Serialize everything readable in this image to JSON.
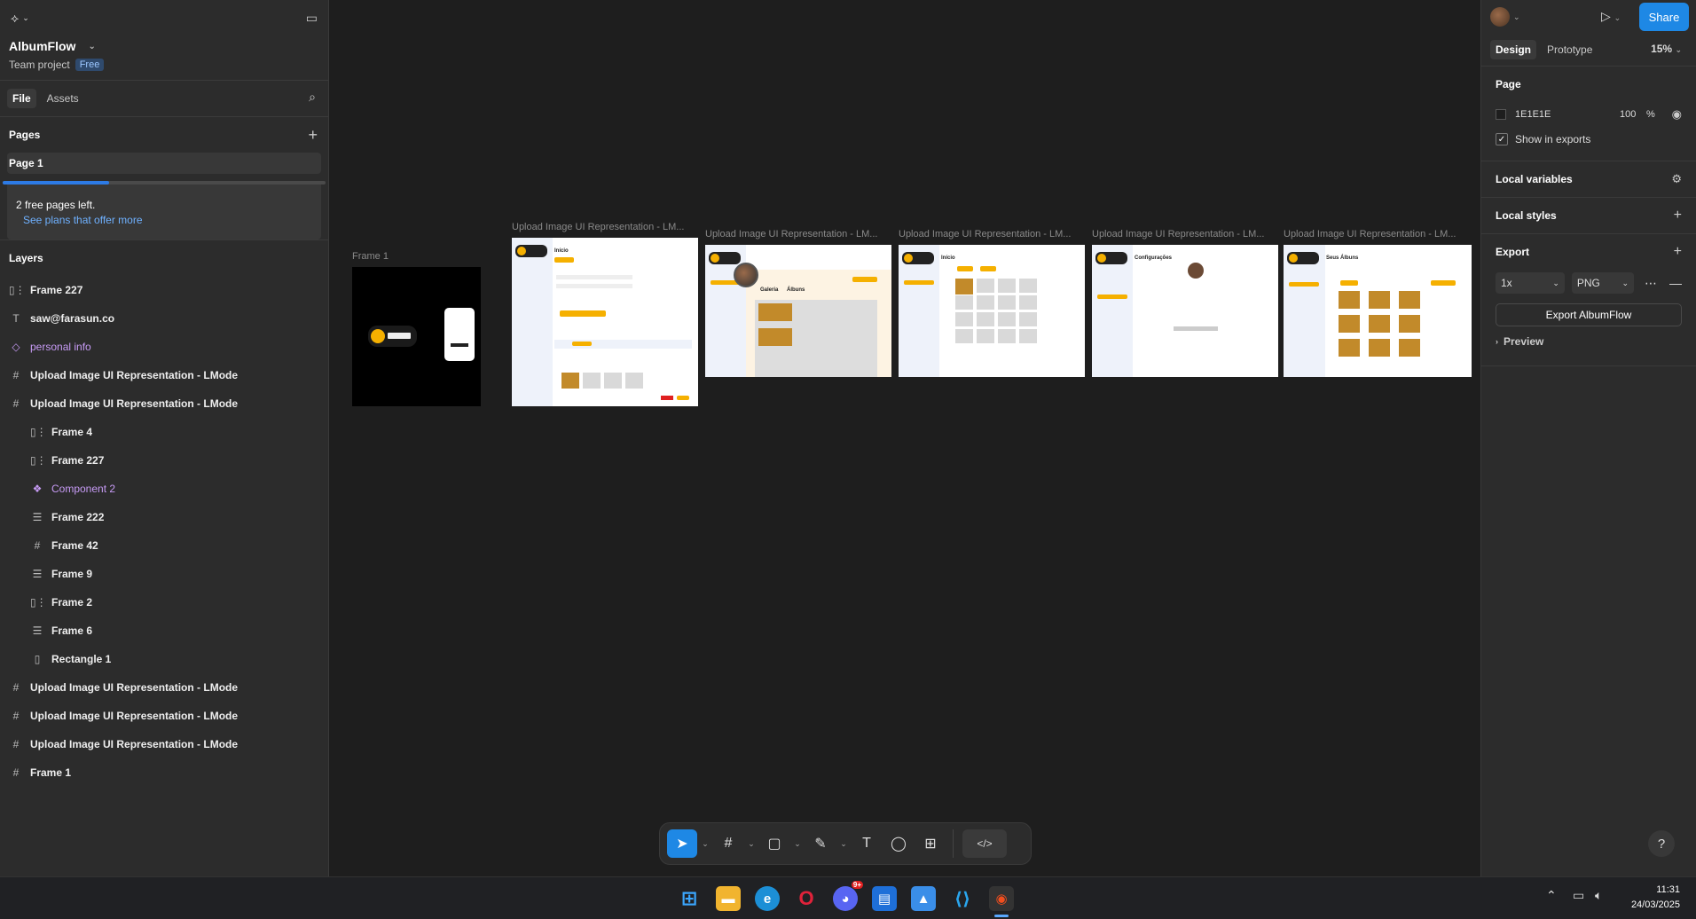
{
  "app": {
    "project_name": "AlbumFlow",
    "project_type": "Team project",
    "plan_badge": "Free"
  },
  "left_panel": {
    "tabs": [
      "File",
      "Assets"
    ],
    "pages_title": "Pages",
    "pages": [
      "Page 1"
    ],
    "free_pages_text": "2 free pages left.",
    "free_pages_link": "See plans that offer more",
    "free_pages_progress": 0.33,
    "layers_title": "Layers",
    "layers": [
      {
        "name": "Frame 227",
        "icon": "auto-layout-icon",
        "glyph": "▯⋮",
        "level": "top",
        "style": ""
      },
      {
        "name": "saw@farasun.co",
        "icon": "text-icon",
        "glyph": "T",
        "level": "top",
        "style": ""
      },
      {
        "name": "personal info",
        "icon": "component-instance-icon",
        "glyph": "◇",
        "level": "top",
        "style": "purple"
      },
      {
        "name": "Upload Image UI Representation - LMode",
        "icon": "frame-icon",
        "glyph": "#",
        "level": "top",
        "style": ""
      },
      {
        "name": "Upload Image UI Representation - LMode",
        "icon": "frame-icon",
        "glyph": "#",
        "level": "top",
        "style": ""
      },
      {
        "name": "Frame 4",
        "icon": "auto-layout-icon",
        "glyph": "▯⋮",
        "level": "child",
        "style": ""
      },
      {
        "name": "Frame 227",
        "icon": "auto-layout-icon",
        "glyph": "▯⋮",
        "level": "child",
        "style": ""
      },
      {
        "name": "Component 2",
        "icon": "component-icon",
        "glyph": "❖",
        "level": "child",
        "style": "purple"
      },
      {
        "name": "Frame 222",
        "icon": "auto-layout-horizontal-icon",
        "glyph": "☰",
        "level": "child",
        "style": ""
      },
      {
        "name": "Frame 42",
        "icon": "frame-icon",
        "glyph": "#",
        "level": "child",
        "style": ""
      },
      {
        "name": "Frame 9",
        "icon": "auto-layout-horizontal-icon",
        "glyph": "☰",
        "level": "child",
        "style": ""
      },
      {
        "name": "Frame 2",
        "icon": "auto-layout-icon",
        "glyph": "▯⋮",
        "level": "child",
        "style": ""
      },
      {
        "name": "Frame 6",
        "icon": "auto-layout-horizontal-icon",
        "glyph": "☰",
        "level": "child",
        "style": ""
      },
      {
        "name": "Rectangle 1",
        "icon": "rectangle-icon",
        "glyph": "▯",
        "level": "child",
        "style": ""
      },
      {
        "name": "Upload Image UI Representation - LMode",
        "icon": "frame-icon",
        "glyph": "#",
        "level": "top",
        "style": ""
      },
      {
        "name": "Upload Image UI Representation - LMode",
        "icon": "frame-icon",
        "glyph": "#",
        "level": "top",
        "style": ""
      },
      {
        "name": "Upload Image UI Representation - LMode",
        "icon": "frame-icon",
        "glyph": "#",
        "level": "top",
        "style": ""
      },
      {
        "name": "Frame 1",
        "icon": "frame-icon",
        "glyph": "#",
        "level": "top",
        "style": ""
      }
    ]
  },
  "canvas": {
    "frame1_label": "Frame 1",
    "frame_label": "Upload Image UI Representation - LM...",
    "frame_titles": [
      "Início",
      "Galeria",
      "Álbuns",
      "Início",
      "Configurações",
      "Seus Álbuns"
    ]
  },
  "toolbar": {
    "tools": [
      "move-tool",
      "frame-tool",
      "shape-tool",
      "pen-tool",
      "text-tool",
      "comment-tool",
      "actions-tool",
      "dev-mode-toggle"
    ]
  },
  "right_panel": {
    "share_label": "Share",
    "tabs": [
      "Design",
      "Prototype"
    ],
    "zoom": "15%",
    "page_title": "Page",
    "page_color": "1E1E1E",
    "page_opacity": "100",
    "percent_sign": "%",
    "show_in_exports": "Show in exports",
    "local_variables": "Local variables",
    "local_styles": "Local styles",
    "export_title": "Export",
    "export_scale": "1x",
    "export_format": "PNG",
    "export_button": "Export AlbumFlow",
    "preview_label": "Preview"
  },
  "taskbar": {
    "time": "11:31",
    "date": "24/03/2025",
    "discord_badge": "9+"
  },
  "colors": {
    "accent": "#1e88e5",
    "canvas_bg": "#1e1e1e",
    "brand_yellow": "#f5b000"
  }
}
